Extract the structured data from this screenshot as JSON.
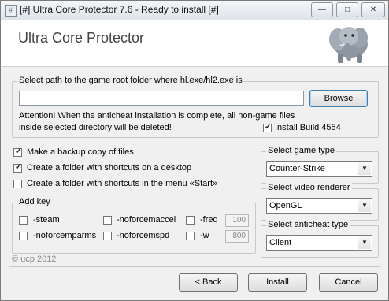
{
  "window": {
    "title": "[#] Ultra Core Protector 7.6 - Ready to install [#]",
    "app_icon": "#"
  },
  "window_controls": {
    "minimize": "—",
    "maximize": "□",
    "close": "✕"
  },
  "header": {
    "app_title": "Ultra Core Protector",
    "logo_icon": "elephant-icon"
  },
  "path_group": {
    "label": "Select path to the game root folder where hl.exe/hl2.exe is",
    "path_value": "",
    "browse_label": "Browse",
    "warning_line1": "Attention! When the anticheat installation is complete, all non-game files",
    "warning_line2": "inside selected directory will be deleted!",
    "install_build_label": "Install Build 4554",
    "install_build_checked": true
  },
  "options": [
    {
      "label": "Make a backup copy of files",
      "checked": true
    },
    {
      "label": "Create a folder with shortcuts on a desktop",
      "checked": true
    },
    {
      "label": "Create a folder with shortcuts in the menu «Start»",
      "checked": false
    }
  ],
  "add_key": {
    "label": "Add key",
    "keys": [
      {
        "label": "-steam",
        "checked": false
      },
      {
        "label": "-noforcemaccel",
        "checked": false
      },
      {
        "label": "-freq",
        "checked": false,
        "value": "100"
      },
      {
        "label": "-noforcemparms",
        "checked": false
      },
      {
        "label": "-noforcemspd",
        "checked": false
      },
      {
        "label": "-w",
        "checked": false,
        "value": "800"
      }
    ]
  },
  "game_type": {
    "label": "Select game type",
    "selected": "Counter-Strike"
  },
  "video_renderer": {
    "label": "Select video renderer",
    "selected": "OpenGL"
  },
  "anticheat_type": {
    "label": "Select anticheat type",
    "selected": "Client"
  },
  "footer": {
    "copyright": "© ucp 2012",
    "back_label": "< Back",
    "install_label": "Install",
    "cancel_label": "Cancel"
  }
}
